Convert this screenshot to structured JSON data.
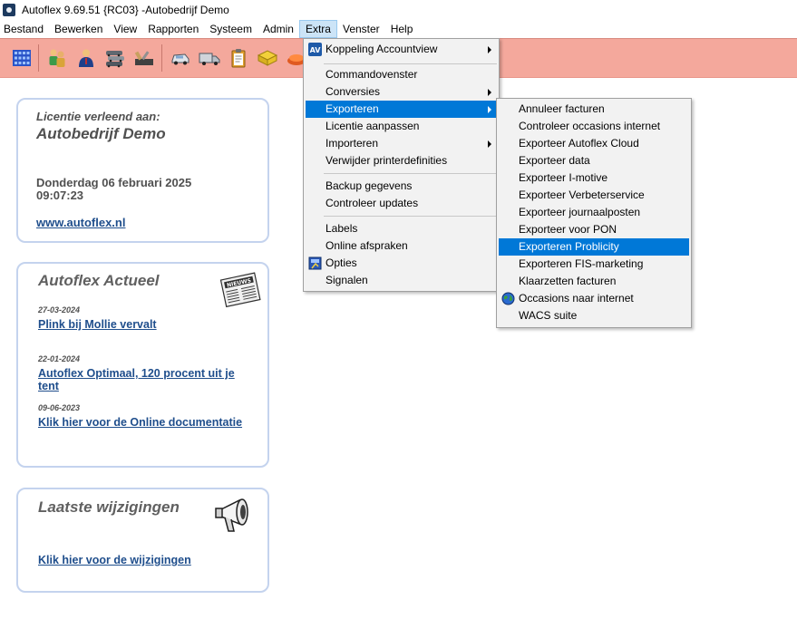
{
  "window": {
    "title": "Autoflex 9.69.51 {RC03} -Autobedrijf Demo"
  },
  "menubar": {
    "items": [
      "Bestand",
      "Bewerken",
      "View",
      "Rapporten",
      "Systeem",
      "Admin",
      "Extra",
      "Venster",
      "Help"
    ],
    "active": "Extra"
  },
  "toolbar": {
    "icons": [
      "grid-icon",
      "people-icon",
      "person-icon",
      "cars-icon",
      "tools-icon",
      "car-icon",
      "truck-icon",
      "clipboard-icon",
      "folder-icon",
      "exit-icon"
    ]
  },
  "license_card": {
    "label": "Licentie verleend aan:",
    "name": "Autobedrijf Demo",
    "date": "Donderdag 06 februari 2025",
    "time": "09:07:23",
    "url": "www.autoflex.nl"
  },
  "news_card": {
    "title": "Autoflex Actueel",
    "items": [
      {
        "date": "27-03-2024",
        "link": "Plink bij Mollie vervalt"
      },
      {
        "date": "22-01-2024",
        "link": "Autoflex Optimaal, 120 procent uit je tent"
      },
      {
        "date": "09-06-2023",
        "link": "Klik hier voor de Online documentatie"
      }
    ]
  },
  "changes_card": {
    "title": "Laatste wijzigingen",
    "link": "Klik hier voor de wijzigingen"
  },
  "extra_menu": {
    "items": [
      {
        "label": "Koppeling Accountview",
        "submenu": true,
        "icon": "accountview-icon"
      },
      {
        "label": "Commandovenster",
        "submenu": false
      },
      {
        "label": "Conversies",
        "submenu": true
      },
      {
        "label": "Exporteren",
        "submenu": true,
        "highlighted": true
      },
      {
        "label": "Licentie aanpassen",
        "submenu": false
      },
      {
        "label": "Importeren",
        "submenu": true
      },
      {
        "label": "Verwijder printerdefinities",
        "submenu": false
      },
      {
        "label": "Backup gegevens",
        "submenu": false
      },
      {
        "label": "Controleer updates",
        "submenu": false
      },
      {
        "label": "Labels",
        "submenu": false
      },
      {
        "label": "Online afspraken",
        "submenu": false
      },
      {
        "label": "Opties",
        "submenu": false,
        "icon": "settings-icon"
      },
      {
        "label": "Signalen",
        "submenu": false
      }
    ]
  },
  "export_menu": {
    "items": [
      {
        "label": "Annuleer facturen"
      },
      {
        "label": "Controleer occasions internet"
      },
      {
        "label": "Exporteer Autoflex Cloud"
      },
      {
        "label": "Exporteer data"
      },
      {
        "label": "Exporteer I-motive"
      },
      {
        "label": "Exporteer Verbeterservice"
      },
      {
        "label": "Exporteer journaalposten"
      },
      {
        "label": "Exporteer voor PON"
      },
      {
        "label": "Exporteren Problicity",
        "highlighted": true
      },
      {
        "label": "Exporteren FIS-marketing"
      },
      {
        "label": "Klaarzetten facturen"
      },
      {
        "label": "Occasions naar internet",
        "icon": "globe-icon"
      },
      {
        "label": "WACS suite"
      }
    ]
  },
  "colors": {
    "toolbar_bg": "#f4a89c",
    "card_border": "#c4d3ee",
    "link": "#1f4e8c",
    "menu_highlight": "#0078d7"
  }
}
